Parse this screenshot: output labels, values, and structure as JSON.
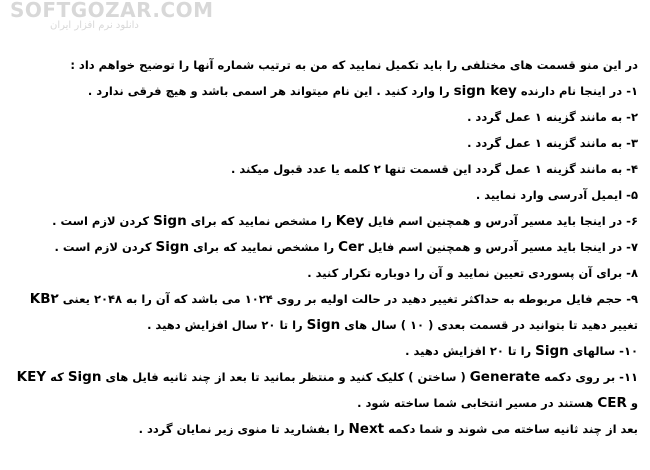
{
  "watermark": {
    "brand": "SOFTGOZAR.COM",
    "tagline": "دانلود نرم افزار ایران"
  },
  "paragraphs": [
    [
      "در این منو قسمت های مختلفی را باید تکمیل نمایید که من به ترتیب شماره آنها را توضیح خواهم داد :"
    ],
    [
      "۱- در اینجا نام دارنده ",
      {
        "t": "sign key"
      },
      " را وارد کنید . این نام میتواند هر اسمی باشد و هیچ فرقی ندارد ."
    ],
    [
      "۲- به مانند گزینه ۱ عمل گردد ."
    ],
    [
      "۳- به مانند گزینه ۱ عمل گردد ."
    ],
    [
      "۴- به مانند گزینه ۱ عمل گردد این قسمت تنها ۲ کلمه یا عدد قبول میکند ."
    ],
    [
      "۵- ایمیل آدرسی وارد نمایید ."
    ],
    [
      "۶- در اینجا باید مسیر آدرس و همچنین اسم فایل ",
      {
        "t": "Key"
      },
      " را مشخص نمایید که برای ",
      {
        "t": "Sign"
      },
      " کردن لازم است ."
    ],
    [
      "۷- در اینجا باید مسیر آدرس و همچنین اسم فایل ",
      {
        "t": "Cer"
      },
      " را مشخص نمایید که برای ",
      {
        "t": "Sign"
      },
      " کردن لازم است ."
    ],
    [
      "۸- برای آن پسوردی تعیین نمایید و آن را دوباره تکرار کنید ."
    ],
    [
      "۹- حجم فایل مربوطه به حداکثر تغییر دهید در حالت اولیه بر روی ۱۰۲۴ می باشد که آن را به ۲۰۴۸ یعنی ",
      {
        "t": "KB۲"
      },
      " تغییر دهید تا بتوانید در قسمت بعدی ( ۱۰ ) سال های ",
      {
        "t": "Sign"
      },
      " را تا ۲۰ سال افزایش دهید ."
    ],
    [
      "۱۰- سالهای ",
      {
        "t": "Sign"
      },
      " را تا ۲۰ افزایش دهید ."
    ],
    [
      "۱۱- بر روی دکمه ",
      {
        "t": "Generate"
      },
      " ( ساختن ) کلیک کنید و منتظر بمانید تا بعد از چند ثانیه فایل های ",
      {
        "t": "Sign"
      },
      " که ",
      {
        "t": "KEY"
      },
      " و ",
      {
        "t": "CER"
      },
      " هستند در مسیر انتخابی شما ساخته شود ."
    ],
    [
      "بعد از چند ثانیه ساخته می شوند و شما دکمه ",
      {
        "t": "Next"
      },
      " را بفشارید تا منوی زیر نمایان گردد ."
    ]
  ]
}
